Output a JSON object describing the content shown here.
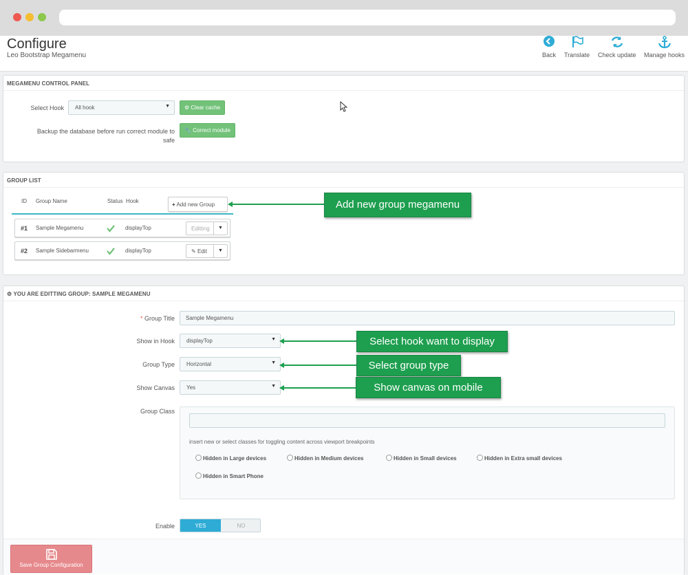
{
  "header": {
    "title": "Configure",
    "subtitle": "Leo Bootstrap Megamenu",
    "toolbar": {
      "back": "Back",
      "translate": "Translate",
      "check_update": "Check update",
      "manage_hooks": "Manage hooks"
    }
  },
  "control_panel": {
    "heading": "MEGAMENU CONTROL PANEL",
    "select_hook_label": "Select Hook",
    "select_hook_value": "All hook",
    "clear_cache": "Clear cache",
    "backup_label_line1": "Backup the database before run correct module to",
    "backup_label_line2": "safe",
    "correct_module": "Correct module"
  },
  "group_list": {
    "heading": "GROUP LIST",
    "columns": {
      "id": "ID",
      "name": "Group Name",
      "status": "Status",
      "hook": "Hook"
    },
    "add_button": "Add new Group",
    "rows": [
      {
        "id": "#1",
        "name": "Sample Megamenu",
        "hook": "displayTop",
        "action": "Editting"
      },
      {
        "id": "#2",
        "name": "Sample Sidebarmenu",
        "hook": "displayTop",
        "action": "Edit"
      }
    ]
  },
  "edit_group": {
    "heading": "YOU ARE EDITTING GROUP: SAMPLE MEGAMENU",
    "group_title_label": "Group Title",
    "required_mark": "*",
    "group_title_value": "Sample Megamenu",
    "show_in_hook_label": "Show in Hook",
    "show_in_hook_value": "displayTop",
    "group_type_label": "Group Type",
    "group_type_value": "Horizontal",
    "show_canvas_label": "Show Canvas",
    "show_canvas_value": "Yes",
    "group_class_label": "Group Class",
    "group_class_value": "",
    "hint": "insert new or select classes for toggling content across viewport breakpoints",
    "radios": {
      "large": "Hidden in Large devices",
      "medium": "Hidden in Medium devices",
      "small": "Hidden in Small devices",
      "xsmall": "Hidden in Extra small devices",
      "phone": "Hidden in Smart Phone"
    },
    "enable_label": "Enable",
    "enable_yes": "YES",
    "enable_no": "NO",
    "enable_value": true,
    "save_button": "Save Group Configuration"
  },
  "callouts": {
    "add_group": "Add new group megamenu",
    "select_hook": "Select hook want to display",
    "select_type": "Select group type",
    "show_canvas": "Show canvas on mobile"
  },
  "colors": {
    "accent_blue": "#2eacd6",
    "green_button": "#72c279",
    "callout_green": "#1e9f4f",
    "save_button": "#e6898c",
    "divider_teal": "#3ab7c3"
  }
}
